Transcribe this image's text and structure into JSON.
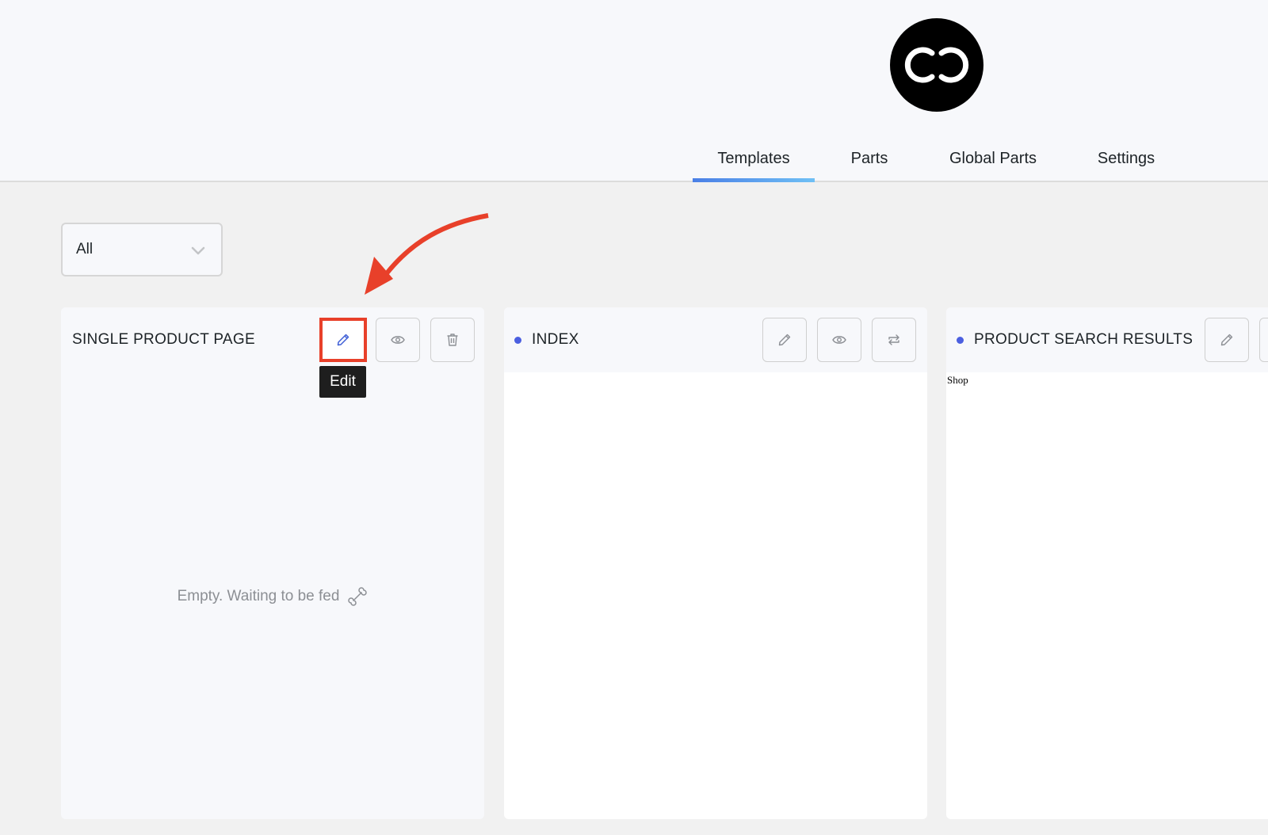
{
  "header": {
    "logo_icon": "infinity-loop-logo-icon",
    "tabs": [
      {
        "label": "Templates",
        "active": true
      },
      {
        "label": "Parts",
        "active": false
      },
      {
        "label": "Global Parts",
        "active": false
      },
      {
        "label": "Settings",
        "active": false
      }
    ],
    "active_tab_accent": "#4a7fe6"
  },
  "filter": {
    "selected": "All"
  },
  "annotation": {
    "arrow_color": "#e8402a",
    "highlight_target": "edit-button"
  },
  "cards": [
    {
      "title": "SINGLE PRODUCT PAGE",
      "status_dot": false,
      "actions": [
        "edit",
        "preview",
        "delete"
      ],
      "tooltip": "Edit",
      "empty_message": "Empty. Waiting to be fed",
      "empty_icon": "bone-icon"
    },
    {
      "title": "INDEX",
      "status_dot": true,
      "status_color": "#4b5fe0",
      "actions": [
        "edit",
        "preview",
        "replace"
      ]
    },
    {
      "title": "PRODUCT SEARCH RESULTS",
      "status_dot": true,
      "status_color": "#4b5fe0",
      "actions": [
        "edit",
        "preview"
      ],
      "preview_text": "Shop"
    }
  ]
}
